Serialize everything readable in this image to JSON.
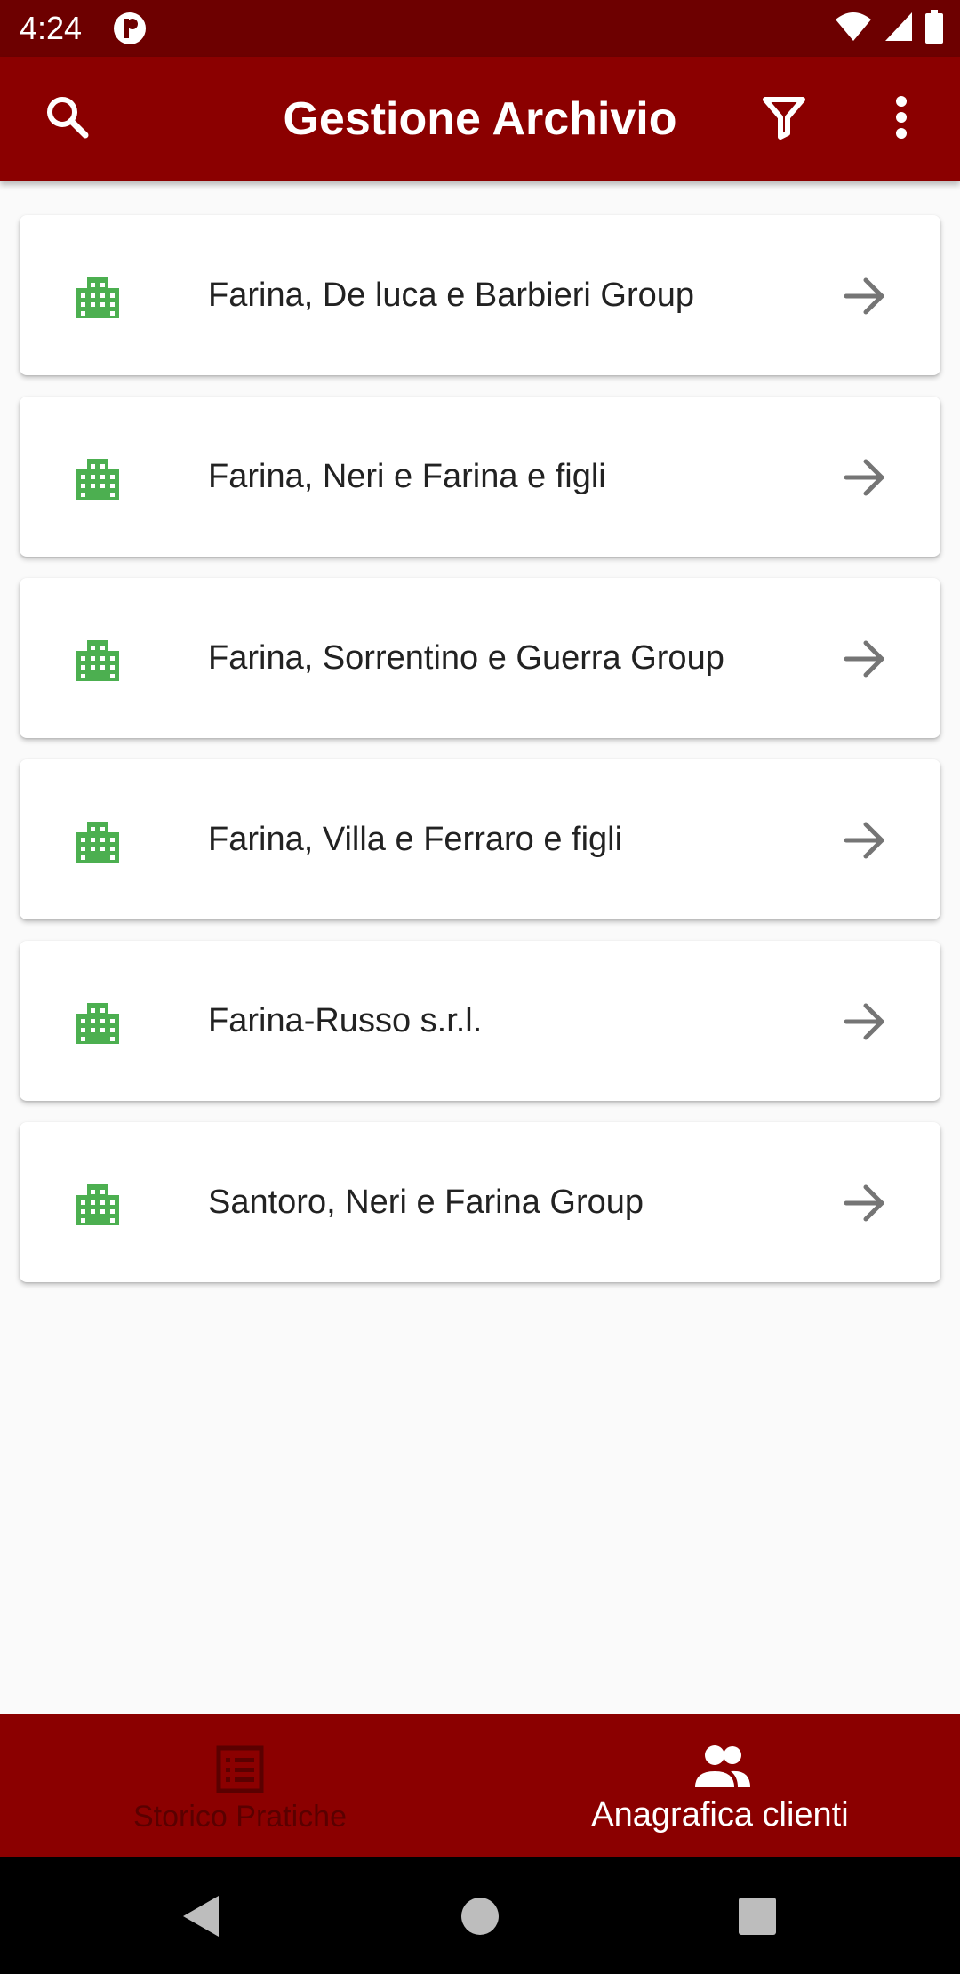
{
  "status_bar": {
    "time": "4:24"
  },
  "app_bar": {
    "title": "Gestione Archivio"
  },
  "clients": [
    {
      "name": "Farina, De luca e Barbieri Group"
    },
    {
      "name": "Farina, Neri e Farina e figli"
    },
    {
      "name": "Farina, Sorrentino e Guerra Group"
    },
    {
      "name": "Farina, Villa e Ferraro e figli"
    },
    {
      "name": "Farina-Russo s.r.l."
    },
    {
      "name": "Santoro, Neri e Farina Group"
    }
  ],
  "bottom_nav": {
    "storico_label": "Storico Pratiche",
    "anagrafica_label": "Anagrafica clienti"
  },
  "colors": {
    "primary": "#8b0000",
    "status_bar": "#6d0000",
    "building_icon": "#4caf50",
    "inactive_nav": "#5a0000"
  },
  "icons": {
    "search": "search-icon",
    "filter": "filter-icon",
    "more": "more-vert-icon",
    "building": "building-icon",
    "arrow": "arrow-forward-icon",
    "storico": "list-icon",
    "anagrafica": "people-icon"
  }
}
